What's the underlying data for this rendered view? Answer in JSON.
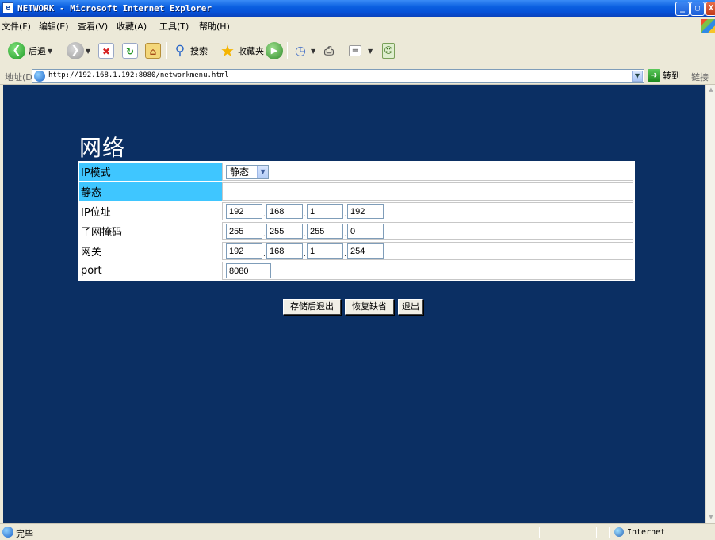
{
  "window": {
    "title": "NETWORK - Microsoft Internet Explorer",
    "buttons": {
      "minimize": "_",
      "maximize": "▢",
      "close": "X"
    }
  },
  "menu": [
    "文件(F)",
    "编辑(E)",
    "查看(V)",
    "收藏(A)",
    "工具(T)",
    "帮助(H)"
  ],
  "toolbar": {
    "back_label": "后退",
    "search_label": "搜索",
    "favorites_label": "收藏夹"
  },
  "address": {
    "label": "地址(D)",
    "url": "http://192.168.1.192:8080/networkmenu.html",
    "go_label": "转到",
    "links_label": "链接"
  },
  "page": {
    "title": "网络",
    "rows": {
      "ip_mode": {
        "label": "IP模式",
        "value": "静态"
      },
      "static": {
        "label": "静态"
      },
      "ip_address": {
        "label": "IP位址",
        "octets": [
          "192",
          "168",
          "1",
          "192"
        ]
      },
      "subnet_mask": {
        "label": "子网掩码",
        "octets": [
          "255",
          "255",
          "255",
          "0"
        ]
      },
      "gateway": {
        "label": "网关",
        "octets": [
          "192",
          "168",
          "1",
          "254"
        ]
      },
      "port": {
        "label": "port",
        "value": "8080"
      }
    },
    "buttons": {
      "save_exit": "存储后退出",
      "restore_defaults": "恢复缺省",
      "exit": "退出"
    }
  },
  "status": {
    "text": "完毕",
    "zone": "Internet"
  }
}
